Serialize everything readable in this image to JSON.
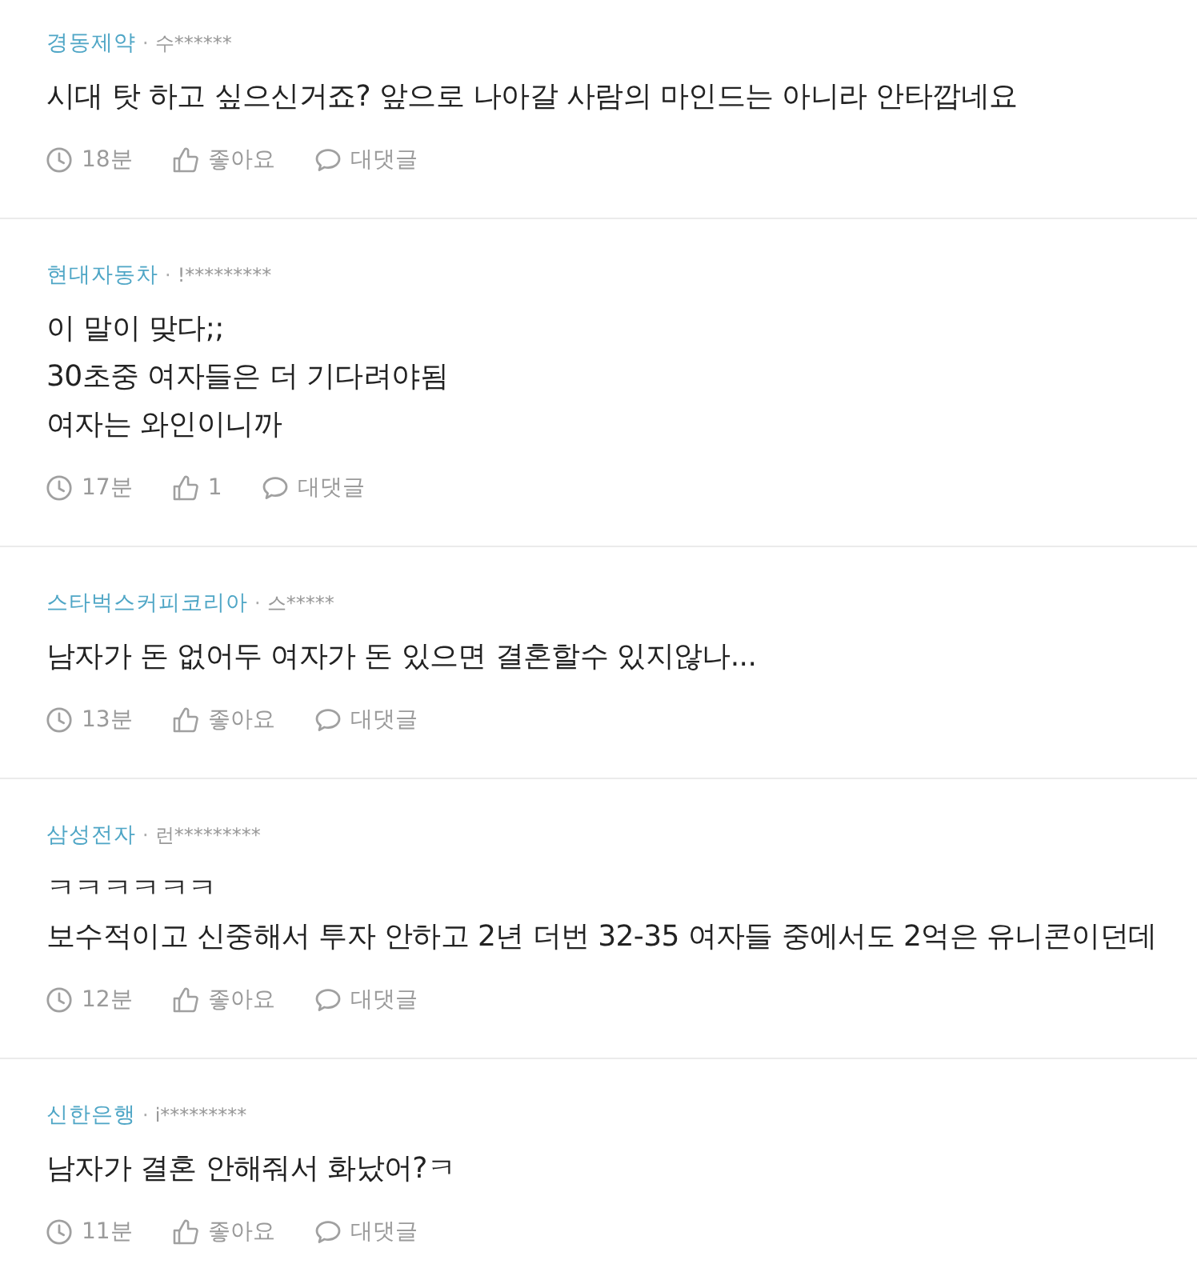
{
  "comments": [
    {
      "company": "경동제약",
      "separator": "·",
      "user": "수******",
      "text": "시대 탓 하고 싶으신거죠? 앞으로 나아갈 사람의 마인드는 아니라 안타깝네요",
      "time": "18분",
      "like": "좋아요",
      "reply": "대댓글"
    },
    {
      "company": "현대자동차",
      "separator": "·",
      "user": "!*********",
      "text": "이 말이 맞다;;\n30초중 여자들은 더 기다려야됨\n여자는 와인이니까",
      "time": "17분",
      "like": "1",
      "reply": "대댓글"
    },
    {
      "company": "스타벅스커피코리아",
      "separator": "·",
      "user": "스*****",
      "text": "남자가 돈 없어두 여자가 돈 있으면 결혼할수 있지않나...",
      "time": "13분",
      "like": "좋아요",
      "reply": "대댓글"
    },
    {
      "company": "삼성전자",
      "separator": "·",
      "user": "런*********",
      "text": "ㅋㅋㅋㅋㅋㅋ\n보수적이고 신중해서 투자 안하고 2년 더번 32-35 여자들 중에서도 2억은 유니콘이던데",
      "time": "12분",
      "like": "좋아요",
      "reply": "대댓글"
    },
    {
      "company": "신한은행",
      "separator": "·",
      "user": "i*********",
      "text": "남자가 결혼 안해줘서 화났어?ㅋ",
      "time": "11분",
      "like": "좋아요",
      "reply": "대댓글"
    }
  ]
}
